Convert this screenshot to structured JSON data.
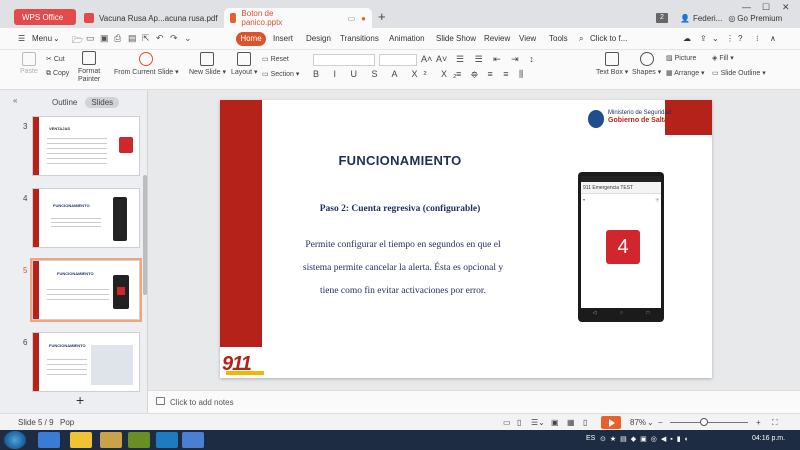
{
  "tabs": {
    "office": "WPS Office",
    "doc1": "Vacuna Rusa Ap...acuna rusa.pdf",
    "doc2": "Boton de panico.pptx",
    "badge": "2",
    "user": "Federi...",
    "premium": "Go Premium"
  },
  "menu": {
    "main": "Menu",
    "items": [
      "Home",
      "Insert",
      "Design",
      "Transitions",
      "Animation",
      "Slide Show",
      "Review",
      "View",
      "Tools"
    ],
    "search": "Click to f..."
  },
  "ribbon": {
    "paste": "Paste",
    "cut": "Cut",
    "copy": "Copy",
    "format_painter_1": "Format",
    "format_painter_2": "Painter",
    "from_current": "From Current Slide",
    "new_slide": "New Slide",
    "layout": "Layout",
    "reset": "Reset",
    "section": "Section",
    "text_box": "Text Box",
    "shapes": "Shapes",
    "picture": "Picture",
    "arrange": "Arrange",
    "fill": "Fill",
    "slide_outline": "Slide Outline"
  },
  "panel": {
    "outline": "Outline",
    "slides": "Slides",
    "thumb_numbers": [
      "3",
      "4",
      "5",
      "6"
    ],
    "add": "+"
  },
  "thumbs": {
    "t3_title": "VENTAJAS",
    "t4_title": "FUNCIONAMIENTO",
    "t5_title": "FUNCIONAMIENTO",
    "t6_title": "FUNCIONAMIENTO"
  },
  "slide": {
    "title": "FUNCIONAMIENTO",
    "subtitle": "Paso 2: Cuenta regresiva (configurable)",
    "body_1": "Permite configurar el tiempo en segundos en que el",
    "body_2": "sistema permite cancelar la alerta. Ésta es opcional y",
    "body_3": "tiene como fin evitar activaciones por error.",
    "ministry_1": "Ministerio de Seguridad",
    "ministry_2": "Gobierno de Salta",
    "logo": "911",
    "phone_title": "911 Emergencia TEST",
    "phone_counter": "4"
  },
  "notes": {
    "placeholder": "Click to add notes"
  },
  "status": {
    "slide_count": "Slide 5 / 9",
    "theme": "Pop",
    "zoom": "87%"
  },
  "taskbar": {
    "lang": "ES",
    "time": "04:16 p.m."
  }
}
